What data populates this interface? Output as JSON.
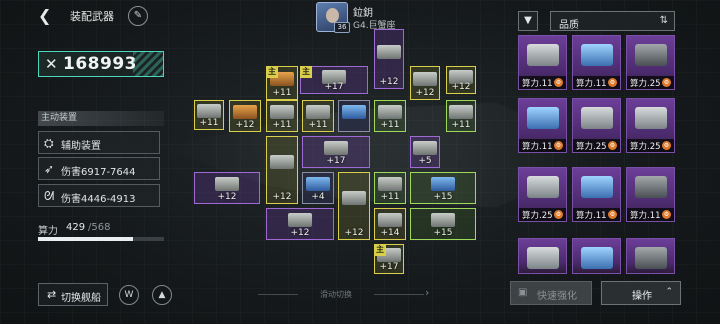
{
  "header": {
    "back_icon": "back-arrow-icon",
    "title": "装配武器",
    "edit_icon": "pencil-icon"
  },
  "pilot": {
    "name": "鉝鈅",
    "level": "36",
    "ship": "G4.巨蟹座"
  },
  "power": {
    "icon": "crossed-swords-icon",
    "value": "168993"
  },
  "equipment": {
    "header": "主动装置",
    "rows": [
      {
        "icon": "device-icon",
        "label": "辅助装置"
      },
      {
        "icon": "missile-icon",
        "label": "伤害6917-7644"
      },
      {
        "icon": "claw-icon",
        "label": "伤害4446-4913"
      }
    ]
  },
  "capacity": {
    "label": "算力",
    "current": "429",
    "total": "/568",
    "fill_ratio": 0.755
  },
  "bottom_left": {
    "switch_ship": "切换舰船",
    "switch_icon": "swap-icon",
    "btn2_icon": "emblem-icon",
    "btn3_icon": "fleet-icon"
  },
  "slide_hint": {
    "label": "滑动切换",
    "arrow": "›"
  },
  "grid": {
    "main_badge": "主",
    "modules": [
      {
        "lvl": "+12",
        "color": "purple",
        "art": "gray"
      },
      {
        "lvl": "+11",
        "color": "yellow",
        "art": "orange",
        "badge": true
      },
      {
        "lvl": "+17",
        "color": "purple",
        "art": "gray",
        "badge": true
      },
      {
        "lvl": "+12",
        "color": "yellow",
        "art": "gray"
      },
      {
        "lvl": "+12",
        "color": "yellow",
        "art": "gray"
      },
      {
        "lvl": "+11",
        "color": "yellow",
        "art": "gray"
      },
      {
        "lvl": "+12",
        "color": "yellow",
        "art": "orange"
      },
      {
        "lvl": "+11",
        "color": "yellow",
        "art": "gray"
      },
      {
        "lvl": "+11",
        "color": "yellow",
        "art": "gray"
      },
      {
        "lvl": "",
        "color": "dark",
        "art": "blue"
      },
      {
        "lvl": "+11",
        "color": "green",
        "art": "gray"
      },
      {
        "lvl": "+11",
        "color": "green",
        "art": "gray"
      },
      {
        "lvl": "+17",
        "color": "purple",
        "art": "gray"
      },
      {
        "lvl": "+5",
        "color": "purple",
        "art": "gray"
      },
      {
        "lvl": "+12",
        "color": "yellow",
        "art": "gray"
      },
      {
        "lvl": "+12",
        "color": "purple",
        "art": "gray"
      },
      {
        "lvl": "+4",
        "color": "dark",
        "art": "blue"
      },
      {
        "lvl": "+12",
        "color": "yellow",
        "art": "gray"
      },
      {
        "lvl": "+11",
        "color": "green",
        "art": "gray"
      },
      {
        "lvl": "+15",
        "color": "green",
        "art": "blue"
      },
      {
        "lvl": "+12",
        "color": "purple",
        "art": "gray"
      },
      {
        "lvl": "+14",
        "color": "yellow",
        "art": "gray"
      },
      {
        "lvl": "+15",
        "color": "green",
        "art": "gray"
      },
      {
        "lvl": "+17",
        "color": "yellow",
        "art": "gray",
        "badge": true
      }
    ]
  },
  "right_panel": {
    "filter_icon": "filter-icon",
    "sort_label": "品质",
    "sort_icon": "sort-order-icon",
    "cards": [
      {
        "cap": "算力.11",
        "gun": "gray"
      },
      {
        "cap": "算力.11",
        "gun": "blue"
      },
      {
        "cap": "算力.25",
        "gun": "dark"
      },
      {
        "cap": "算力.11",
        "gun": "blue"
      },
      {
        "cap": "算力.25",
        "gun": "gray"
      },
      {
        "cap": "算力.25",
        "gun": "gray"
      },
      {
        "cap": "算力.25",
        "gun": "gray"
      },
      {
        "cap": "算力.11",
        "gun": "blue"
      },
      {
        "cap": "算力.11",
        "gun": "dark"
      },
      {
        "cap": "",
        "gun": "gray"
      },
      {
        "cap": "",
        "gun": "blue"
      },
      {
        "cap": "",
        "gun": "dark"
      }
    ],
    "quick_enhance": "快速强化",
    "lock_icon": "lock-icon",
    "operate": "操作",
    "operate_icon": "chevron-up-icon"
  },
  "colors": {
    "accent_teal": "#4fd6c0",
    "module_yellow": "#d9cf4a",
    "module_purple": "#a06ad6",
    "module_green": "#9ed95a"
  }
}
